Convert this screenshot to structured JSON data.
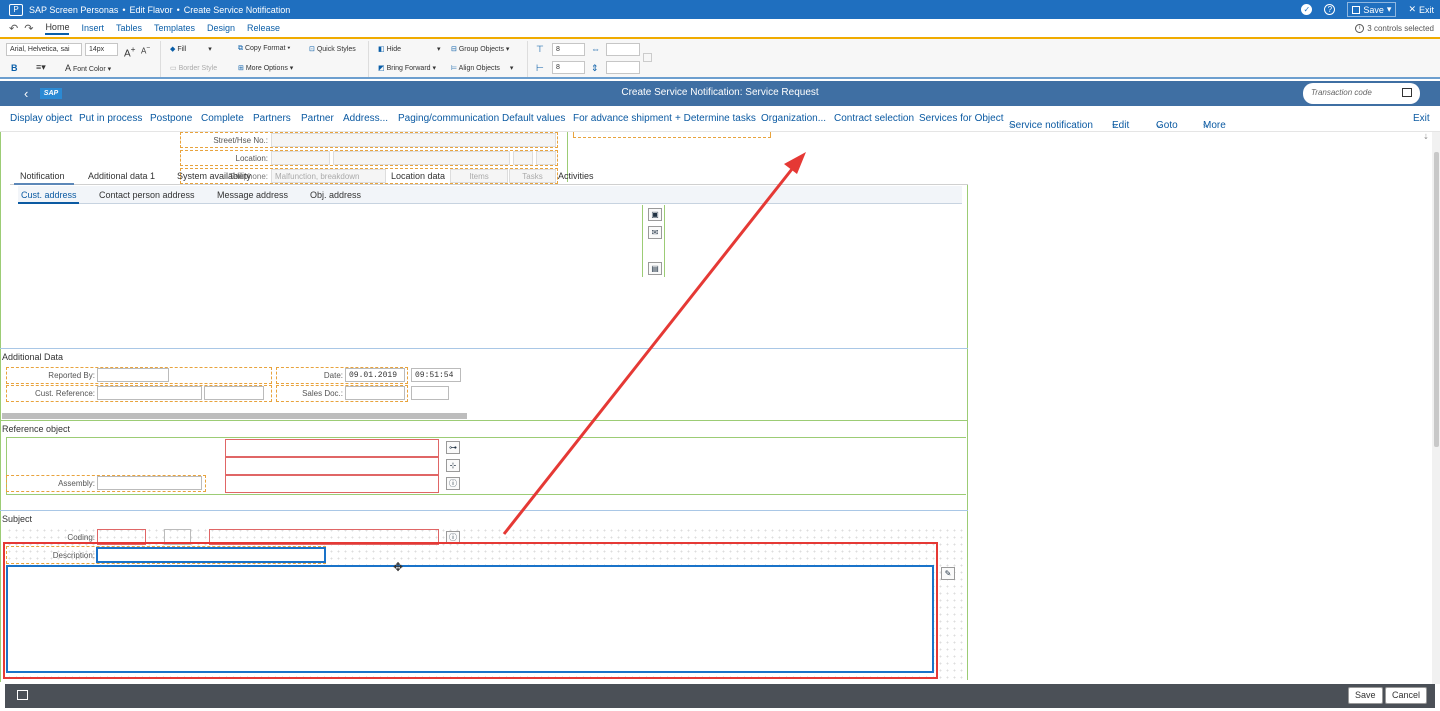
{
  "personas_bar": {
    "app_name": "SAP Screen Personas",
    "sep": "•",
    "mode": "Edit Flavor",
    "screen": "Create Service Notification",
    "help": "?",
    "save_label": "Save",
    "exit_label": "Exit"
  },
  "ribbon_tabs": {
    "items": [
      "Home",
      "Insert",
      "Tables",
      "Templates",
      "Design",
      "Release"
    ],
    "selection_info": "3 controls selected"
  },
  "ribbon": {
    "font_family": "Arial, Helvetica, sai",
    "font_size": "14px",
    "fill": "Fill",
    "font_color": "Font Color",
    "border_style": "Border Style",
    "copy_format": "Copy Format",
    "more_options": "More Options",
    "quick_styles": "Quick Styles",
    "hide": "Hide",
    "bring_forward": "Bring Forward",
    "group_objects": "Group Objects",
    "align_objects": "Align Objects",
    "top_value": "8",
    "left_value": "8",
    "bold": "B",
    "italic": "I",
    "font_color_glyph": "A",
    "grow_font": "A",
    "shrink_font": "A"
  },
  "shell": {
    "logo": "SAP",
    "title": "Create Service Notification: Service Request",
    "tcode_placeholder": "Transaction code"
  },
  "app_toolbar": {
    "items": [
      "Display object",
      "Put in process",
      "Postpone",
      "Complete",
      "Partners",
      "Partner",
      "Address...",
      "Paging/communication",
      "Default values",
      "For advance shipment",
      "+ Determine tasks",
      "Organization...",
      "Contract selection",
      "Services for Object",
      "Service notification",
      "Edit",
      "Goto",
      "More"
    ],
    "exit": "Exit"
  },
  "address_block": {
    "street_label": "Street/Hse No.:",
    "location_label": "Location:",
    "telephone_label": "Telephone:"
  },
  "tabs_main": {
    "items": [
      "Notification",
      "Additional data 1",
      "System availability",
      "Location data",
      "Items",
      "Tasks",
      "Activities"
    ],
    "overlay_ghost": "Malfunction, breakdown"
  },
  "tabs_sub": {
    "items": [
      "Cust. address",
      "Contact person address",
      "Message address",
      "Obj. address"
    ]
  },
  "additional_data": {
    "title": "Additional Data",
    "reported_by_label": "Reported By:",
    "cust_reference_label": "Cust. Reference:",
    "date_label": "Date:",
    "date_value": "09.01.2019",
    "time_value": "09:51:54",
    "sales_doc_label": "Sales Doc.:"
  },
  "reference_object": {
    "title": "Reference object",
    "assembly_label": "Assembly:"
  },
  "subject": {
    "title": "Subject",
    "coding_label": "Coding:",
    "description_label": "Description:"
  },
  "footer": {
    "save": "Save",
    "cancel": "Cancel"
  },
  "colors": {
    "personas_blue": "#1f6fbf",
    "ribbon_accent": "#f0ab00",
    "shell_blue": "#3f6fa3",
    "annotation_red": "#e53935",
    "selection_blue": "#1a73c9"
  }
}
